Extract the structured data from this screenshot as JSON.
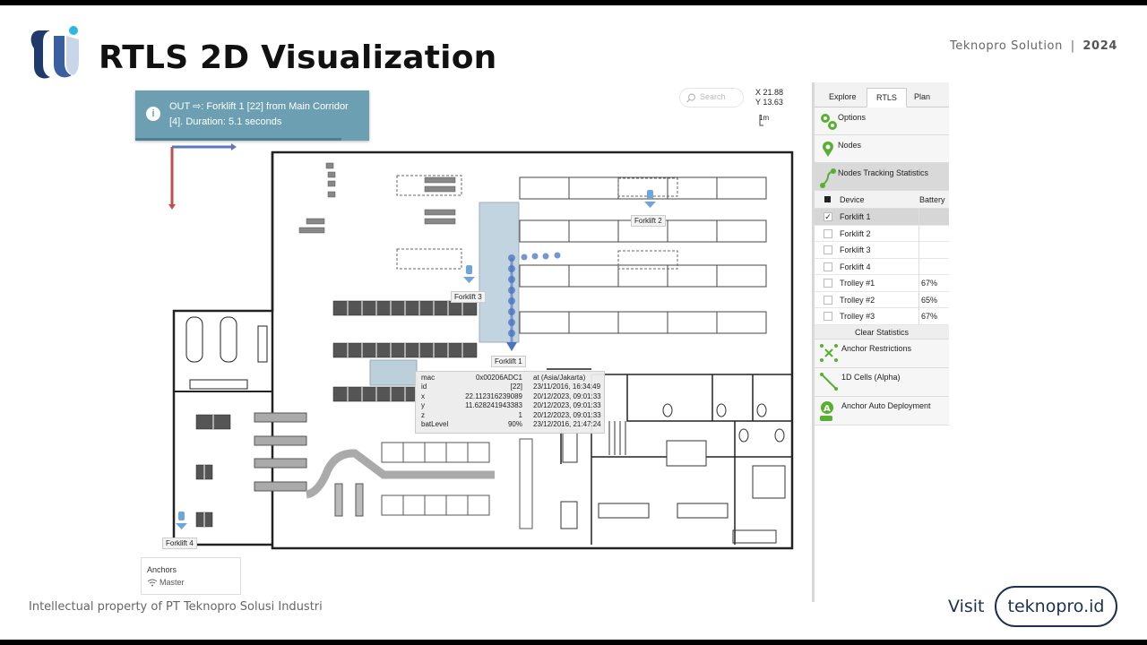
{
  "slide": {
    "title": "RTLS 2D Visualization",
    "company": "Teknopro Solution",
    "separator": "|",
    "year": "2024",
    "footer": "Intellectual property of PT Teknopro Solusi Industri",
    "visit_label": "Visit",
    "visit_url": "teknopro.id"
  },
  "notification": {
    "line1": "OUT ⇨: Forklift 1 [22] from Main Corridor",
    "line2": "[4]. Duration: 5.1 seconds",
    "icon": "info-icon"
  },
  "search": {
    "placeholder": "Search"
  },
  "cursor_coords": {
    "x": "X 21.88",
    "y": "Y 13.63",
    "scale": "1m"
  },
  "panel": {
    "tabs": [
      "Explore",
      "RTLS",
      "Plan"
    ],
    "active_tab": "RTLS",
    "sections": {
      "options": "Options",
      "nodes": "Nodes",
      "nodes_tracking": "Nodes Tracking Statistics"
    },
    "table": {
      "headers": [
        "Device",
        "Battery"
      ],
      "rows": [
        {
          "device": "Forklift 1",
          "battery": "",
          "checked": "✓"
        },
        {
          "device": "Forklift 2",
          "battery": "",
          "checked": ""
        },
        {
          "device": "Forklift 3",
          "battery": "",
          "checked": ""
        },
        {
          "device": "Forklift 4",
          "battery": "",
          "checked": ""
        },
        {
          "device": "Trolley #1",
          "battery": "67%",
          "checked": ""
        },
        {
          "device": "Trolley #2",
          "battery": "65%",
          "checked": ""
        },
        {
          "device": "Trolley #3",
          "battery": "67%",
          "checked": ""
        }
      ]
    },
    "clear_label": "Clear Statistics",
    "tools": {
      "anchor_restrictions": "Anchor Restrictions",
      "cells_1d": "1D Cells (Alpha)",
      "anchor_auto": "Anchor Auto Deployment"
    }
  },
  "map_labels": {
    "forklift1": "Forklift 1",
    "forklift2": "Forklift 2",
    "forklift3": "Forklift 3",
    "forklift4": "Forklift 4"
  },
  "info_popup": {
    "rows": [
      {
        "k": "mac",
        "v": "0x00206ADC1",
        "t": "at (Asia/Jakarta)"
      },
      {
        "k": "id",
        "v": "[22]",
        "t": "23/11/2016, 16:34:49"
      },
      {
        "k": "x",
        "v": "22.112316239089",
        "t": "20/12/2023, 09:01:33"
      },
      {
        "k": "y",
        "v": "11.628241943383",
        "t": "20/12/2023, 09:01:33"
      },
      {
        "k": "z",
        "v": "1",
        "t": "20/12/2023, 09:01:33"
      },
      {
        "k": "batLevel",
        "v": "90%",
        "t": "23/12/2016, 21:47:24"
      }
    ]
  },
  "anchors_legend": {
    "title": "Anchors",
    "item": "Master"
  },
  "colors": {
    "accent": "#6d9fb3",
    "tag_blue": "#4a72c0",
    "green": "#58b030",
    "navy": "#1e3050"
  }
}
